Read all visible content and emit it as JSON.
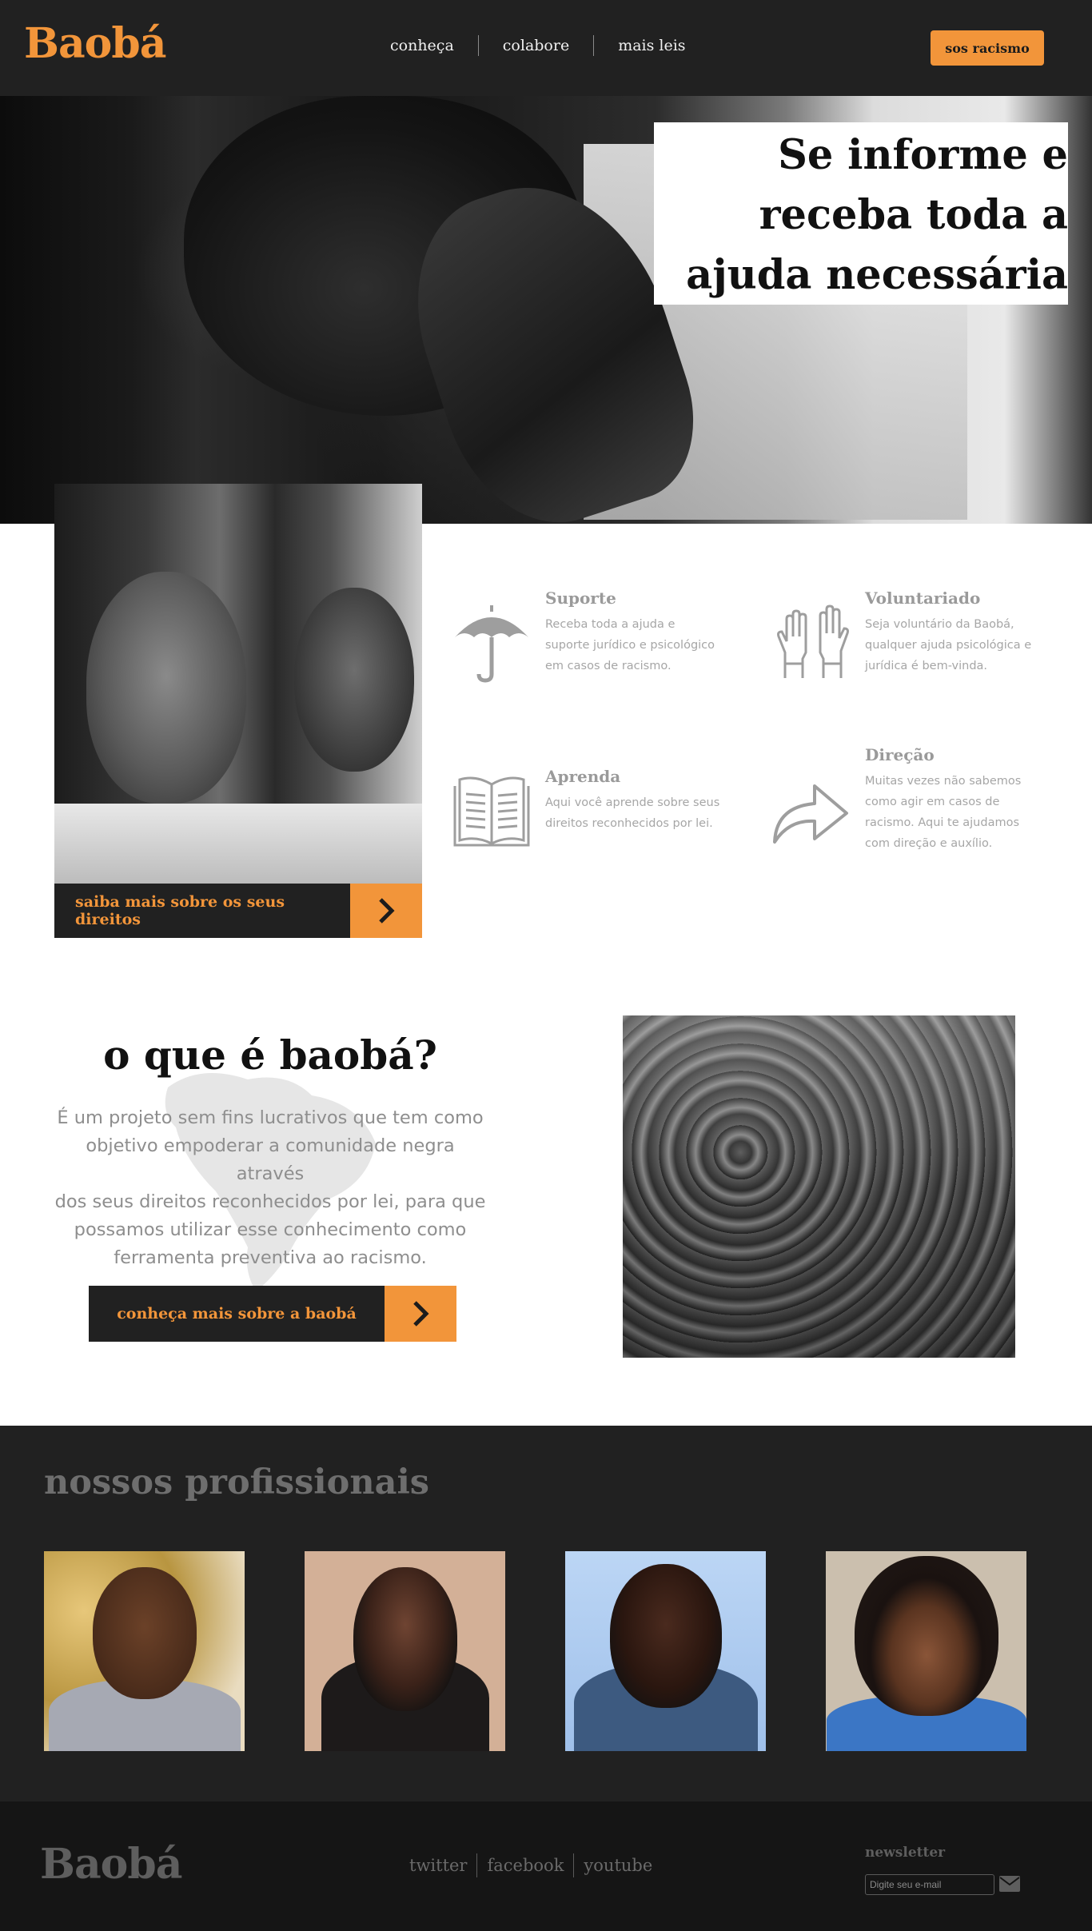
{
  "header": {
    "logo": "Baobá",
    "nav": [
      "conheça",
      "colabore",
      "mais leis"
    ],
    "sos_button": "sos racismo"
  },
  "hero": {
    "title_lines": [
      "Se informe e",
      "receba toda a",
      "ajuda necessária"
    ]
  },
  "rights_button": {
    "label": "saiba mais sobre os seus direitos"
  },
  "features": [
    {
      "icon": "umbrella-icon",
      "title": "Suporte",
      "lines": [
        "Receba toda a ajuda e",
        "suporte jurídico e psicológico",
        "em casos de racismo."
      ]
    },
    {
      "icon": "raised-hands-icon",
      "title": "Voluntariado",
      "lines": [
        "Seja voluntário da Baobá,",
        "qualquer ajuda psicológica e",
        "jurídica é bem-vinda."
      ]
    },
    {
      "icon": "open-book-icon",
      "title": "Aprenda",
      "lines": [
        "Aqui você aprende sobre seus",
        "direitos reconhecidos por lei."
      ]
    },
    {
      "icon": "share-arrow-icon",
      "title": "Direção",
      "lines": [
        "Muitas vezes não sabemos",
        "como agir em casos de",
        "racismo. Aqui te ajudamos",
        "com direção e auxílio."
      ]
    }
  ],
  "about": {
    "title": "o que é baobá?",
    "lines": [
      "É um projeto sem fins lucrativos que tem como",
      "objetivo empoderar a comunidade negra através",
      "dos seus direitos reconhecidos por lei, para que",
      "possamos utilizar esse conhecimento como",
      "ferramenta preventiva ao racismo."
    ],
    "button": "conheça mais sobre a baobá"
  },
  "professionals": {
    "title": "nossos profissionais"
  },
  "footer": {
    "logo": "Baobá",
    "links": [
      "twitter",
      "facebook",
      "youtube"
    ],
    "newsletter_label": "newsletter",
    "newsletter_placeholder": "Digite seu e-mail"
  },
  "colors": {
    "accent": "#f2953a",
    "dark": "#212121",
    "footer": "#151515"
  }
}
